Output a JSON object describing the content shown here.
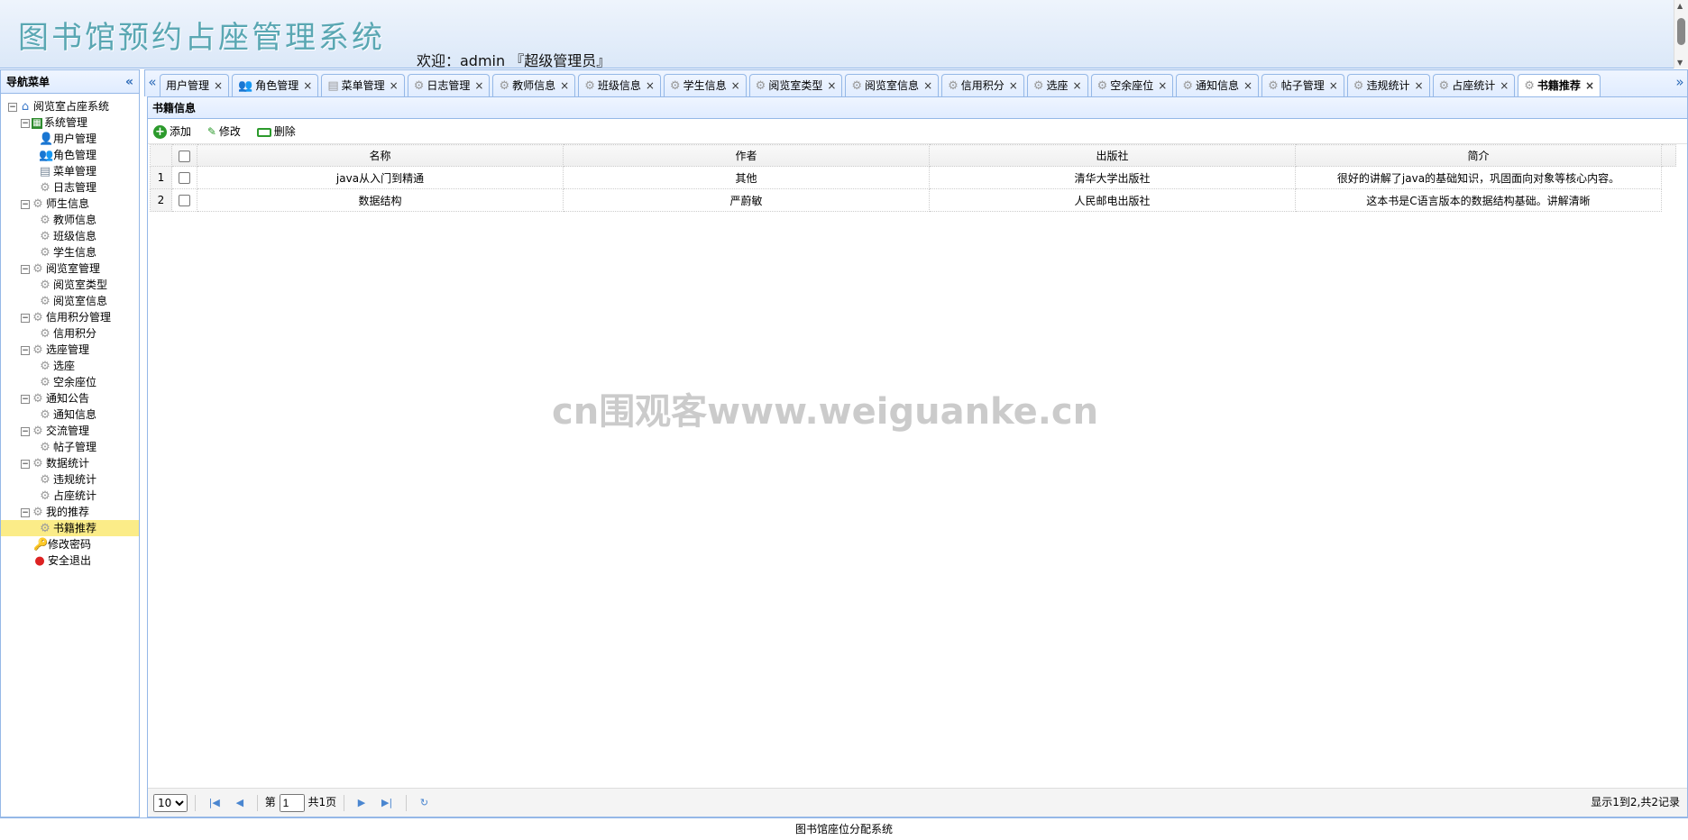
{
  "header": {
    "title": "图书馆预约占座管理系统",
    "welcome": "欢迎：admin 『超级管理员』"
  },
  "sidebar": {
    "title": "导航菜单",
    "collapse_icon": "double-chevron-left-icon",
    "tree": [
      {
        "label": "阅览室占座系统",
        "level": 0,
        "icon": "home-icon",
        "toggle": "⊟"
      },
      {
        "label": "系统管理",
        "level": 1,
        "icon": "system-icon",
        "toggle": "⊟"
      },
      {
        "label": "用户管理",
        "level": 2,
        "icon": "user-icon"
      },
      {
        "label": "角色管理",
        "level": 2,
        "icon": "users-icon"
      },
      {
        "label": "菜单管理",
        "level": 2,
        "icon": "menu-icon"
      },
      {
        "label": "日志管理",
        "level": 2,
        "icon": "gear-icon"
      },
      {
        "label": "师生信息",
        "level": 1,
        "icon": "gear-icon",
        "toggle": "⊟"
      },
      {
        "label": "教师信息",
        "level": 2,
        "icon": "gear-icon"
      },
      {
        "label": "班级信息",
        "level": 2,
        "icon": "gear-icon"
      },
      {
        "label": "学生信息",
        "level": 2,
        "icon": "gear-icon"
      },
      {
        "label": "阅览室管理",
        "level": 1,
        "icon": "gear-icon",
        "toggle": "⊟"
      },
      {
        "label": "阅览室类型",
        "level": 2,
        "icon": "gear-icon"
      },
      {
        "label": "阅览室信息",
        "level": 2,
        "icon": "gear-icon"
      },
      {
        "label": "信用积分管理",
        "level": 1,
        "icon": "gear-icon",
        "toggle": "⊟"
      },
      {
        "label": "信用积分",
        "level": 2,
        "icon": "gear-icon"
      },
      {
        "label": "选座管理",
        "level": 1,
        "icon": "gear-icon",
        "toggle": "⊟"
      },
      {
        "label": "选座",
        "level": 2,
        "icon": "gear-icon"
      },
      {
        "label": "空余座位",
        "level": 2,
        "icon": "gear-icon"
      },
      {
        "label": "通知公告",
        "level": 1,
        "icon": "gear-icon",
        "toggle": "⊟"
      },
      {
        "label": "通知信息",
        "level": 2,
        "icon": "gear-icon"
      },
      {
        "label": "交流管理",
        "level": 1,
        "icon": "gear-icon",
        "toggle": "⊟"
      },
      {
        "label": "帖子管理",
        "level": 2,
        "icon": "gear-icon"
      },
      {
        "label": "数据统计",
        "level": 1,
        "icon": "gear-icon",
        "toggle": "⊟"
      },
      {
        "label": "违规统计",
        "level": 2,
        "icon": "gear-icon"
      },
      {
        "label": "占座统计",
        "level": 2,
        "icon": "gear-icon"
      },
      {
        "label": "我的推荐",
        "level": 1,
        "icon": "gear-icon",
        "toggle": "⊟"
      },
      {
        "label": "书籍推荐",
        "level": 2,
        "icon": "gear-icon",
        "selected": true
      },
      {
        "label": "修改密码",
        "level": 1,
        "icon": "key-icon"
      },
      {
        "label": "安全退出",
        "level": 1,
        "icon": "exit-icon"
      }
    ]
  },
  "tabs": [
    {
      "label": "用户管理",
      "icon": "user-icon",
      "show_icon": false
    },
    {
      "label": "角色管理",
      "icon": "users-icon"
    },
    {
      "label": "菜单管理",
      "icon": "menu-icon"
    },
    {
      "label": "日志管理",
      "icon": "gear-icon"
    },
    {
      "label": "教师信息",
      "icon": "gear-icon"
    },
    {
      "label": "班级信息",
      "icon": "gear-icon"
    },
    {
      "label": "学生信息",
      "icon": "gear-icon"
    },
    {
      "label": "阅览室类型",
      "icon": "gear-icon"
    },
    {
      "label": "阅览室信息",
      "icon": "gear-icon"
    },
    {
      "label": "信用积分",
      "icon": "gear-icon"
    },
    {
      "label": "选座",
      "icon": "gear-icon"
    },
    {
      "label": "空余座位",
      "icon": "gear-icon"
    },
    {
      "label": "通知信息",
      "icon": "gear-icon"
    },
    {
      "label": "帖子管理",
      "icon": "gear-icon"
    },
    {
      "label": "违规统计",
      "icon": "gear-icon"
    },
    {
      "label": "占座统计",
      "icon": "gear-icon"
    },
    {
      "label": "书籍推荐",
      "icon": "gear-icon",
      "active": true
    }
  ],
  "panel": {
    "title": "书籍信息",
    "toolbar": {
      "add": "添加",
      "edit": "修改",
      "delete": "删除"
    },
    "columns": [
      "名称",
      "作者",
      "出版社",
      "简介"
    ],
    "rows": [
      {
        "num": "1",
        "name": "java从入门到精通",
        "author": "其他",
        "publisher": "清华大学出版社",
        "summary": "很好的讲解了java的基础知识，巩固面向对象等核心内容。"
      },
      {
        "num": "2",
        "name": "数据结构",
        "author": "严蔚敏",
        "publisher": "人民邮电出版社",
        "summary": "这本书是C语言版本的数据结构基础。讲解清晰"
      }
    ]
  },
  "pager": {
    "page_size": "10",
    "page_size_options": [
      "10"
    ],
    "page_prefix": "第",
    "page_value": "1",
    "page_suffix": "共1页",
    "info": "显示1到2,共2记录"
  },
  "footer": "图书馆座位分配系统",
  "watermark": "cn围观客www.weiguanke.cn",
  "colors": {
    "border": "#95b8e7",
    "selected": "#fbec88",
    "title": "#5aa7b3"
  }
}
